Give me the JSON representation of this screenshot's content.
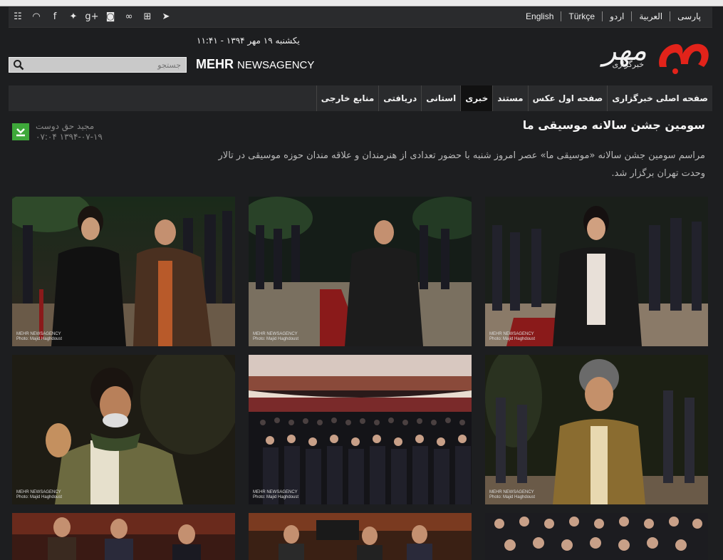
{
  "header": {
    "languages": [
      "English",
      "Türkçe",
      "اردو",
      "العربية",
      "پارسی"
    ],
    "date": "یکشنبه ۱۹ مهر ۱۳۹۴ - ۱۱:۴۱",
    "brand_bold": "MEHR",
    "brand_rest": "NEWSAGENCY",
    "logo_text": "مهر",
    "logo_sub": "خبرگزاری",
    "search_placeholder": "جستجو",
    "social_icons": [
      "list-icon",
      "rss-icon",
      "facebook-icon",
      "twitter-icon",
      "google-plus-icon",
      "instagram-icon",
      "aparat-icon",
      "windows-icon",
      "telegram-icon"
    ],
    "accent_color": "#e2231a"
  },
  "nav": {
    "items": [
      "صفحه اصلی خبرگزاری",
      "صفحه اول عکس",
      "مستند",
      "خبری",
      "استانی",
      "دریافتی",
      "منابع خارجی"
    ],
    "active": "خبری"
  },
  "article": {
    "title": "سومین جشن سالانه موسیقی ما",
    "author": "مجید حق دوست",
    "datetime": "۱۳۹۴-۰۷-۱۹ ۰۷:۰۴",
    "lead": "مراسم سومین جشن سالانه «موسیقی ما» عصر امروز شنبه با حضور تعدادی از هنرمندان و علاقه مندان حوزه موسیقی در تالار وحدت تهران برگزار شد."
  },
  "photos": {
    "watermark_line1": "MEHR NEWSAGENCY",
    "watermark_line2": "Photo: Majid Haghdoust",
    "count": 9
  }
}
